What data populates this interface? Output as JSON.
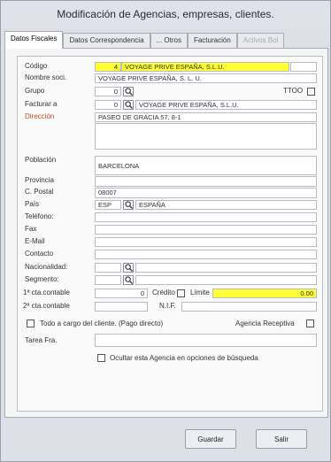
{
  "window": {
    "title": "Modificación de Agencias, empresas, clientes."
  },
  "tabs": [
    {
      "label": "Datos Fiscales"
    },
    {
      "label": "Datos Correspondencia"
    },
    {
      "label": "... Otros"
    },
    {
      "label": "Facturación"
    },
    {
      "label": "Activos Bol"
    }
  ],
  "form": {
    "codigo": {
      "label": "Código",
      "num": "4",
      "name": "VOYAGE PRIVE ESPAÑA, S.L.U."
    },
    "nombre_social": {
      "label": "Nombre soci.",
      "value": "VOYAGE PRIVE ESPAÑA, S. L. U."
    },
    "grupo": {
      "label": "Grupo",
      "num": "0"
    },
    "ttoo": {
      "label": "TTOO"
    },
    "facturar_a": {
      "label": "Facturar a",
      "num": "0",
      "name": "VOYAGE PRIVE ESPAÑA, S.L.U."
    },
    "direccion": {
      "label": "Dirección",
      "value": "PASEO DE GRACIA 57, 8-1"
    },
    "poblacion": {
      "label": "Población",
      "value": "BARCELONA"
    },
    "provincia": {
      "label": "Provincia",
      "value": ""
    },
    "cpostal": {
      "label": "C. Postal",
      "value": "08007"
    },
    "pais": {
      "label": "País",
      "code": "ESP",
      "name": "ESPAÑA"
    },
    "telefono": {
      "label": "Teléfono:"
    },
    "fax": {
      "label": "Fax"
    },
    "email": {
      "label": "E-Mail"
    },
    "contacto": {
      "label": "Contacto"
    },
    "nacionalidad": {
      "label": "Nacionalidad:"
    },
    "segmento": {
      "label": "Segmento:"
    },
    "cta1": {
      "label": "1ª cta.contable",
      "value": "0"
    },
    "credito": {
      "label": "Crédito"
    },
    "limite": {
      "label": "Límite",
      "value": "0.00"
    },
    "cta2": {
      "label": "2ª cta.contable"
    },
    "nif": {
      "label": "N.I.F."
    },
    "todo_cargo": {
      "label": "Todo a cargo del cliente. (Pago directo)"
    },
    "agencia_receptiva": {
      "label": "Agencia Receptiva"
    },
    "tarea": {
      "label": "Tarea Fra."
    },
    "ocultar": {
      "label": "Ocultar esta Agencia en opciones de búsqueda"
    }
  },
  "buttons": {
    "guardar": "Guardar",
    "salir": "Salir"
  },
  "colors": {
    "highlight": "#ffff33"
  }
}
